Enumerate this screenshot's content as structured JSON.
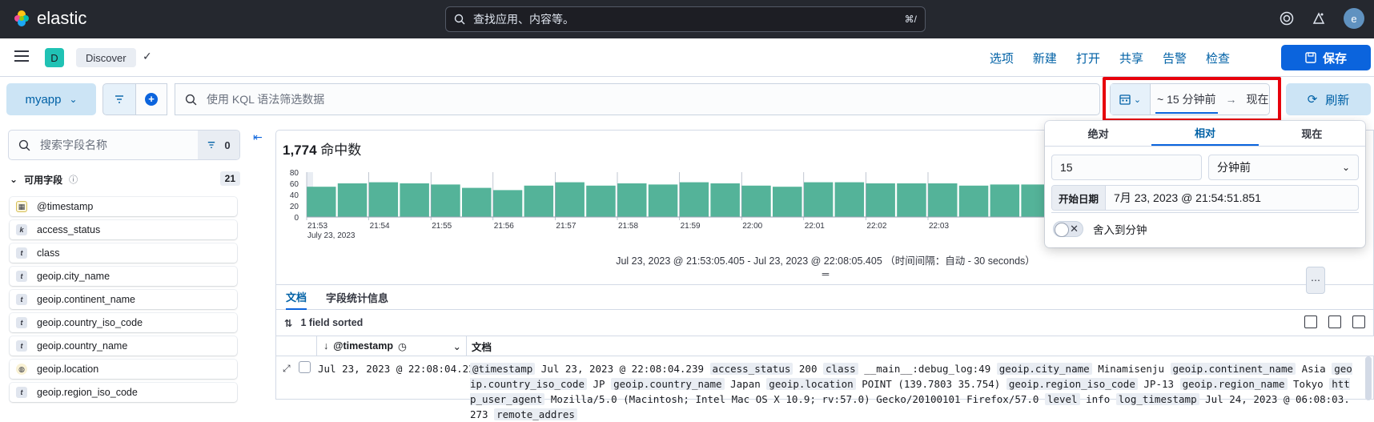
{
  "topbar": {
    "brand": "elastic",
    "search_placeholder": "查找应用、内容等。",
    "search_shortcut": "⌘/",
    "avatar_letter": "e"
  },
  "appbar": {
    "space_letter": "D",
    "breadcrumb": "Discover",
    "nav": [
      "选项",
      "新建",
      "打开",
      "共享",
      "告警",
      "检查"
    ],
    "save_label": "保存"
  },
  "query": {
    "data_view": "myapp",
    "kql_placeholder": "使用 KQL 语法筛选数据",
    "date_start": "~ 15 分钟前",
    "date_end": "现在",
    "refresh_label": "刷新"
  },
  "sidebar": {
    "search_placeholder": "搜索字段名称",
    "filter_count": "0",
    "available_label": "可用字段",
    "available_count": "21",
    "fields": [
      {
        "name": "@timestamp",
        "type": "date",
        "type_glyph": "▦"
      },
      {
        "name": "access_status",
        "type": "keyword",
        "type_glyph": "k"
      },
      {
        "name": "class",
        "type": "text",
        "type_glyph": "t"
      },
      {
        "name": "geoip.city_name",
        "type": "text",
        "type_glyph": "t"
      },
      {
        "name": "geoip.continent_name",
        "type": "text",
        "type_glyph": "t"
      },
      {
        "name": "geoip.country_iso_code",
        "type": "text",
        "type_glyph": "t"
      },
      {
        "name": "geoip.country_name",
        "type": "text",
        "type_glyph": "t"
      },
      {
        "name": "geoip.location",
        "type": "geo",
        "type_glyph": "◍"
      },
      {
        "name": "geoip.region_iso_code",
        "type": "text",
        "type_glyph": "t"
      }
    ]
  },
  "main": {
    "hits_count": "1,774",
    "hits_label": "命中数",
    "range_text": "Jul 23, 2023 @ 21:53:05.405 - Jul 23, 2023 @ 22:08:05.405 （时间间隔：自动 - 30 seconds）",
    "tabs": [
      "文档",
      "字段统计信息"
    ],
    "sorted_label": "1 field sorted",
    "col_timestamp": "@timestamp",
    "col_document": "文档",
    "row_timestamp": "Jul 23, 2023 @ 22:08:04.239",
    "row_doc": [
      {
        "k": "@timestamp",
        "v": "Jul 23, 2023 @ 22:08:04.239"
      },
      {
        "k": "access_status",
        "v": "200"
      },
      {
        "k": "class",
        "v": "__main__:debug_log:49"
      },
      {
        "k": "geoip.city_name",
        "v": "Minamisenju"
      },
      {
        "k": "geoip.continent_name",
        "v": "Asia"
      },
      {
        "k": "geoip.country_iso_code",
        "v": "JP"
      },
      {
        "k": "geoip.country_name",
        "v": "Japan"
      },
      {
        "k": "geoip.location",
        "v": "POINT (139.7803 35.754)"
      },
      {
        "k": "geoip.region_iso_code",
        "v": "JP-13"
      },
      {
        "k": "geoip.region_name",
        "v": "Tokyo"
      },
      {
        "k": "http_user_agent",
        "v": "Mozilla/5.0 (Macintosh; Intel Mac OS X 10.9; rv:57.0) Gecko/20100101 Firefox/57.0"
      },
      {
        "k": "level",
        "v": "info"
      },
      {
        "k": "log_timestamp",
        "v": "Jul 24, 2023 @ 06:08:03.273"
      },
      {
        "k": "remote_addres",
        "v": ""
      }
    ]
  },
  "popover": {
    "tabs": [
      "绝对",
      "相对",
      "现在"
    ],
    "active_tab": "相对",
    "amount": "15",
    "unit": "分钟前",
    "start_label": "开始日期",
    "start_value": "7月 23, 2023 @ 21:54:51.851",
    "round_label": "舍入到分钟"
  },
  "chart_data": {
    "type": "bar",
    "x_axis_sublabel": "July 23, 2023",
    "ylim": [
      0,
      80
    ],
    "y_ticks": [
      0,
      20,
      40,
      60,
      80
    ],
    "x_ticks": [
      "21:53",
      "21:54",
      "21:55",
      "21:56",
      "21:57",
      "21:58",
      "21:59",
      "22:00",
      "22:01",
      "22:02",
      "22:03"
    ],
    "values": [
      54,
      60,
      62,
      60,
      58,
      52,
      48,
      56,
      62,
      56,
      60,
      58,
      62,
      60,
      56,
      54,
      62,
      62,
      60,
      60,
      60,
      56,
      58,
      58,
      70
    ],
    "color": "#54b399"
  }
}
